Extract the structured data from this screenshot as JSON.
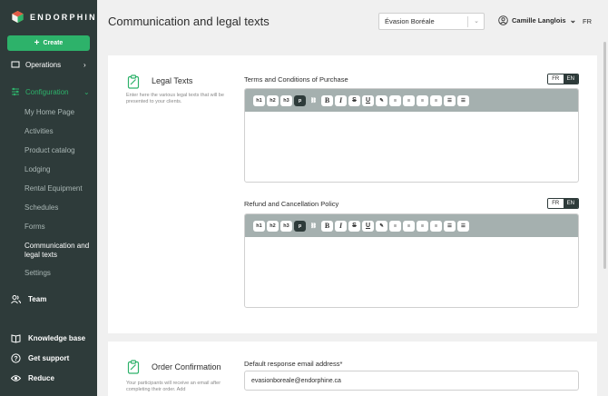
{
  "app": {
    "brand": "ENDORPHINE",
    "page_title": "Communication and legal texts",
    "org_select": "Évasion Boréale",
    "user_name": "Camille Langlois",
    "lang": "FR"
  },
  "sidebar": {
    "create_label": "Create",
    "operations_label": "Operations",
    "configuration_label": "Configuration",
    "sub_items": [
      "My Home Page",
      "Activities",
      "Product catalog",
      "Lodging",
      "Rental Equipment",
      "Schedules",
      "Forms",
      "Communication and legal texts",
      "Settings"
    ],
    "team_label": "Team",
    "knowledge_label": "Knowledge base",
    "support_label": "Get support",
    "reduce_label": "Reduce"
  },
  "legal": {
    "title": "Legal Texts",
    "desc": "Enter here the various legal texts that will be presented to your clients.",
    "terms_label": "Terms and Conditions of Purchase",
    "refund_label": "Refund and Cancellation Policy",
    "fr": "FR",
    "en": "EN"
  },
  "toolbar": {
    "h1": "h1",
    "h2": "h2",
    "h3": "h3",
    "p": "p",
    "bold": "B",
    "italic": "I",
    "strike": "S",
    "underline": "U"
  },
  "order": {
    "title": "Order Confirmation",
    "desc": "Your participants will receive an email after completing their order. Add",
    "email_label": "Default response email address*",
    "email_value": "evasionboreale@endorphine.ca"
  },
  "colors": {
    "sidebar": "#2e3b3a",
    "accent": "#2db26a",
    "toolbar": "#a5b0af"
  }
}
